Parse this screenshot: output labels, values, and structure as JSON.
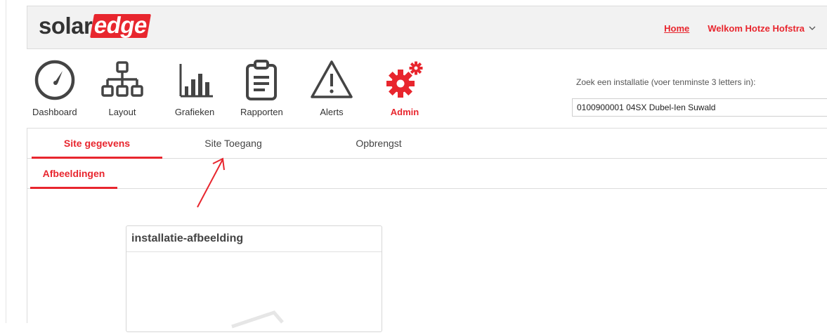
{
  "header": {
    "logo_solar": "solar",
    "logo_edge": "edge",
    "home_link": "Home",
    "welcome": "Welkom Hotze Hofstra"
  },
  "nav": {
    "items": [
      {
        "label": "Dashboard",
        "icon": "dashboard-gauge-icon"
      },
      {
        "label": "Layout",
        "icon": "layout-tree-icon"
      },
      {
        "label": "Grafieken",
        "icon": "chart-bars-icon"
      },
      {
        "label": "Rapporten",
        "icon": "clipboard-report-icon"
      },
      {
        "label": "Alerts",
        "icon": "warning-triangle-icon"
      },
      {
        "label": "Admin",
        "icon": "gear-icon",
        "active": true
      }
    ]
  },
  "search": {
    "label": "Zoek een installatie (voer tenminste 3 letters in):",
    "value": "0100900001 04SX Dubel-Ien Suwald"
  },
  "tabs": [
    {
      "label": "Site gegevens",
      "active": true
    },
    {
      "label": "Site Toegang",
      "active": false
    },
    {
      "label": "Opbrengst",
      "active": false
    }
  ],
  "subtabs": [
    {
      "label": "Afbeeldingen",
      "active": true
    }
  ],
  "panel": {
    "title": "installatie-afbeelding"
  },
  "colors": {
    "accent": "#e8262e",
    "text": "#333333",
    "header_bg": "#f2f2f2"
  }
}
